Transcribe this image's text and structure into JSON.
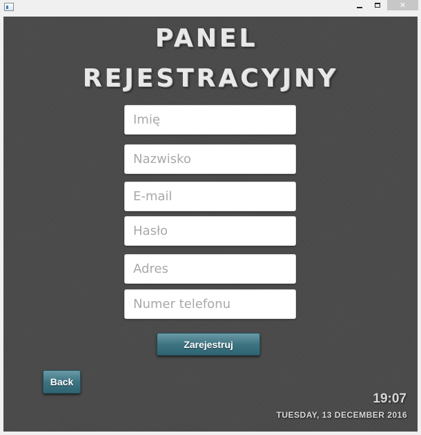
{
  "window": {
    "icon": "app-window-icon",
    "controls": {
      "minimize": "minimize-icon",
      "maximize": "maximize-icon",
      "close_glyph": "✕"
    }
  },
  "header": {
    "title_line1": "PANEL",
    "title_line2": "REJESTRACYJNY"
  },
  "form": {
    "fields": [
      {
        "name": "imie",
        "placeholder": "Imię",
        "value": ""
      },
      {
        "name": "nazwisko",
        "placeholder": "Nazwisko",
        "value": ""
      },
      {
        "name": "email",
        "placeholder": "E-mail",
        "value": ""
      },
      {
        "name": "haslo",
        "placeholder": "Hasło",
        "value": ""
      },
      {
        "name": "adres",
        "placeholder": "Adres",
        "value": ""
      },
      {
        "name": "telefon",
        "placeholder": "Numer telefonu",
        "value": ""
      }
    ],
    "submit_label": "Zarejestruj"
  },
  "nav": {
    "back_label": "Back"
  },
  "status": {
    "time": "19:07",
    "date": "TUESDAY, 13 DECEMBER 2016"
  },
  "colors": {
    "background": "#4a4a4a",
    "button": "#3e7482",
    "title_text": "#e8e8e8"
  }
}
